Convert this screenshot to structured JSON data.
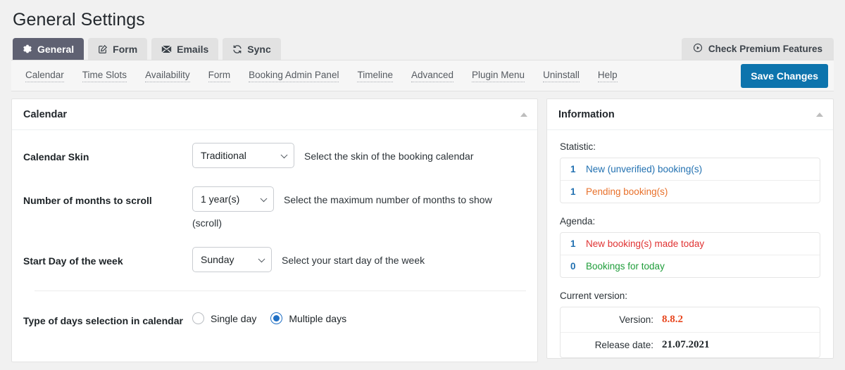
{
  "page": {
    "title": "General Settings"
  },
  "tabs": [
    {
      "label": "General",
      "icon": "gear-icon",
      "active": true
    },
    {
      "label": "Form",
      "icon": "pencil-square-icon",
      "active": false
    },
    {
      "label": "Emails",
      "icon": "envelope-icon",
      "active": false
    },
    {
      "label": "Sync",
      "icon": "sync-icon",
      "active": false
    }
  ],
  "premium": {
    "label": "Check Premium Features",
    "icon": "play-circle-icon"
  },
  "subtabs": [
    "Calendar",
    "Time Slots",
    "Availability",
    "Form",
    "Booking Admin Panel",
    "Timeline",
    "Advanced",
    "Plugin Menu",
    "Uninstall",
    "Help"
  ],
  "save": {
    "label": "Save Changes",
    "color": "#0d74ad"
  },
  "calendar_panel": {
    "title": "Calendar",
    "collapse_icon": "triangle-up-icon",
    "fields": [
      {
        "label": "Calendar Skin",
        "value": "Traditional",
        "options": [
          "Traditional"
        ],
        "description": "Select the skin of the booking calendar",
        "note": ""
      },
      {
        "label": "Number of months to scroll",
        "value": "1 year(s)",
        "options": [
          "1 year(s)"
        ],
        "description": "Select the maximum number of months to show",
        "note": "(scroll)"
      },
      {
        "label": "Start Day of the week",
        "value": "Sunday",
        "options": [
          "Sunday"
        ],
        "description": "Select your start day of the week",
        "note": ""
      }
    ],
    "days_selection": {
      "label": "Type of days selection in calendar",
      "options": [
        {
          "label": "Single day",
          "checked": false
        },
        {
          "label": "Multiple days",
          "checked": true
        }
      ]
    }
  },
  "information_panel": {
    "title": "Information",
    "collapse_icon": "triangle-up-icon",
    "statistic": {
      "title": "Statistic:",
      "rows": [
        {
          "count": "1",
          "label": "New (unverified) booking(s)",
          "color": "#2271b1"
        },
        {
          "count": "1",
          "label": "Pending booking(s)",
          "color": "#e8702a"
        }
      ]
    },
    "agenda": {
      "title": "Agenda:",
      "rows": [
        {
          "count": "1",
          "label": "New booking(s) made today",
          "color": "#e03232"
        },
        {
          "count": "0",
          "label": "Bookings for today",
          "color": "#1f9d3a"
        }
      ]
    },
    "current_version": {
      "title": "Current version:",
      "rows": [
        {
          "key": "Version:",
          "value": "8.8.2",
          "color": "#e8461e"
        },
        {
          "key": "Release date:",
          "value": "21.07.2021",
          "color": "#1d2327"
        }
      ]
    }
  }
}
